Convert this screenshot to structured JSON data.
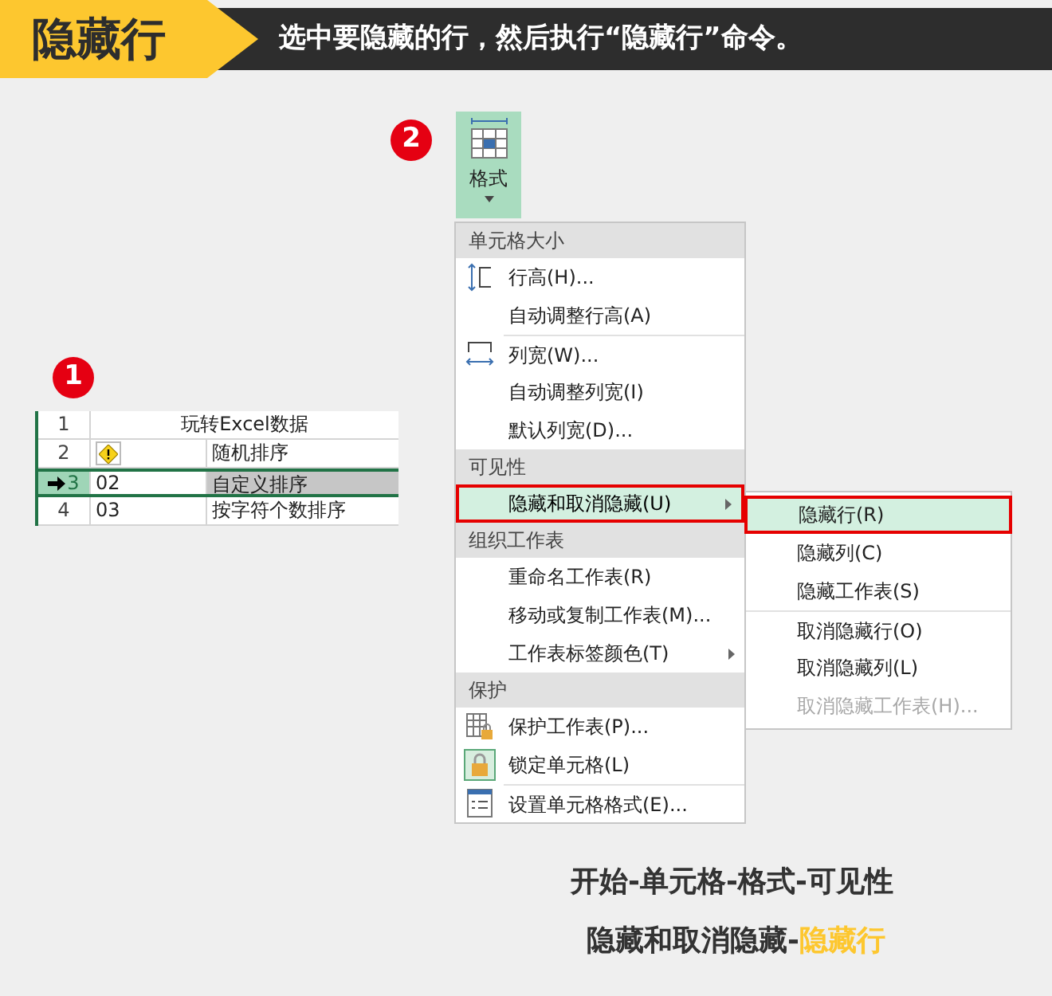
{
  "header": {
    "tag": "隐藏行",
    "instruction": "选中要隐藏的行，然后执行“隐藏行”命令。"
  },
  "steps": [
    "1",
    "2"
  ],
  "sheet": {
    "rows": [
      {
        "kind": "title",
        "number": "1",
        "selected": false,
        "col_b": "玩转Excel数据"
      },
      {
        "kind": "warning",
        "number": "2",
        "selected": false,
        "col_b": "随机排序"
      },
      {
        "kind": "data",
        "number": "3",
        "selected": true,
        "col_a": "02",
        "col_b": "自定义排序"
      },
      {
        "kind": "data",
        "number": "4",
        "selected": false,
        "col_a": "03",
        "col_b": "按字符个数排序"
      }
    ]
  },
  "format_button": {
    "label": "格式"
  },
  "menu": {
    "sections": [
      {
        "header": "单元格大小",
        "items": [
          {
            "label": "行高(H)...",
            "kind": "row-height",
            "selected": false,
            "submenu": false,
            "divider_before": false
          },
          {
            "label": "自动调整行高(A)",
            "kind": "plain",
            "selected": false,
            "submenu": false,
            "divider_before": false
          },
          {
            "label": "列宽(W)...",
            "kind": "column-width",
            "selected": false,
            "submenu": false,
            "divider_before": true
          },
          {
            "label": "自动调整列宽(I)",
            "kind": "plain",
            "selected": false,
            "submenu": false,
            "divider_before": false
          },
          {
            "label": "默认列宽(D)...",
            "kind": "plain",
            "selected": false,
            "submenu": false,
            "divider_before": false
          }
        ]
      },
      {
        "header": "可见性",
        "items": [
          {
            "label": "隐藏和取消隐藏(U)",
            "kind": "plain",
            "selected": true,
            "submenu": true,
            "divider_before": false
          }
        ]
      },
      {
        "header": "组织工作表",
        "items": [
          {
            "label": "重命名工作表(R)",
            "kind": "plain",
            "selected": false,
            "submenu": false,
            "divider_before": false
          },
          {
            "label": "移动或复制工作表(M)...",
            "kind": "plain",
            "selected": false,
            "submenu": false,
            "divider_before": false
          },
          {
            "label": "工作表标签颜色(T)",
            "kind": "plain",
            "selected": false,
            "submenu": true,
            "divider_before": false
          }
        ]
      },
      {
        "header": "保护",
        "items": [
          {
            "label": "保护工作表(P)...",
            "kind": "protect",
            "selected": false,
            "submenu": false,
            "divider_before": false
          },
          {
            "label": "锁定单元格(L)",
            "kind": "lock",
            "selected": false,
            "submenu": false,
            "divider_before": false
          },
          {
            "label": "设置单元格格式(E)...",
            "kind": "dialog",
            "selected": false,
            "submenu": false,
            "divider_before": true
          }
        ]
      }
    ]
  },
  "submenu": {
    "items": [
      {
        "label": "隐藏行(R)",
        "selected": true,
        "disabled": false,
        "divider_before": false
      },
      {
        "label": "隐藏列(C)",
        "selected": false,
        "disabled": false,
        "divider_before": false
      },
      {
        "label": "隐藏工作表(S)",
        "selected": false,
        "disabled": false,
        "divider_before": false
      },
      {
        "label": "取消隐藏行(O)",
        "selected": false,
        "disabled": false,
        "divider_before": true
      },
      {
        "label": "取消隐藏列(L)",
        "selected": false,
        "disabled": false,
        "divider_before": false
      },
      {
        "label": "取消隐藏工作表(H)...",
        "selected": false,
        "disabled": true,
        "divider_before": false
      }
    ]
  },
  "path": {
    "line_1": "开始-单元格-格式-可见性",
    "line_2": "隐藏和取消隐藏-",
    "line_2_highlight": "隐藏行"
  }
}
